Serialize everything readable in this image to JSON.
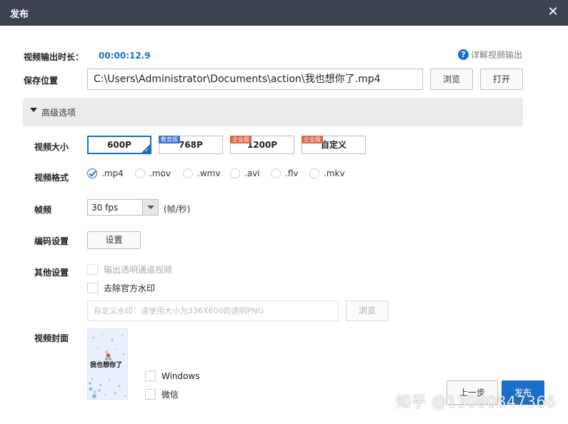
{
  "window": {
    "title": "发布",
    "close_glyph": "✕"
  },
  "duration": {
    "label": "视频输出时长：",
    "value": "00:00:12.9"
  },
  "help": {
    "icon": "question-circle-icon",
    "label": "详解视频输出"
  },
  "save_location": {
    "label": "保存位置",
    "path": "C:\\Users\\Administrator\\Documents\\action\\我也想你了.mp4",
    "browse_label": "浏览",
    "open_label": "打开"
  },
  "advanced": {
    "label": "高级选项",
    "expanded": true
  },
  "video_size": {
    "label": "视频大小",
    "options": [
      {
        "label": "600P",
        "badge": "",
        "selected": true
      },
      {
        "label": "768P",
        "badge": "教育版",
        "selected": false
      },
      {
        "label": "1200P",
        "badge": "企业版",
        "selected": false
      },
      {
        "label": "自定义",
        "badge": "企业版",
        "selected": false
      }
    ]
  },
  "video_format": {
    "label": "视频格式",
    "options": [
      {
        "label": ".mp4",
        "selected": true
      },
      {
        "label": ".mov",
        "selected": false
      },
      {
        "label": ".wmv",
        "selected": false
      },
      {
        "label": ".avi",
        "selected": false
      },
      {
        "label": ".flv",
        "selected": false
      },
      {
        "label": ".mkv",
        "selected": false
      }
    ]
  },
  "frame_rate": {
    "label": "帧频",
    "value": "30 fps",
    "unit": "(帧/秒)"
  },
  "encoding": {
    "label": "编码设置",
    "button_label": "设置"
  },
  "other": {
    "label": "其他设置",
    "transparent_channel": {
      "label": "输出透明通道视频",
      "checked": false,
      "disabled": true
    },
    "remove_watermark": {
      "label": "去除官方水印",
      "checked": false,
      "disabled": false
    },
    "custom_watermark_placeholder": "自定义水印：请使用大小为336X600的透明PNG",
    "watermark_browse_label": "浏览"
  },
  "cover": {
    "label": "视频封面",
    "thumbnail_text": "我也想你了",
    "options": [
      {
        "label": "Windows",
        "checked": false
      },
      {
        "label": "微信",
        "checked": false
      }
    ]
  },
  "footer": {
    "prev_label": "上一步",
    "publish_label": "发布"
  },
  "overlay_watermark": "知乎 @13080847366",
  "colors": {
    "accent": "#1a6fc8",
    "titlebar": "#3d4450",
    "section_bg": "#ebebeb",
    "badge_edu": "#3b6fd1",
    "badge_ent": "#d9644a"
  }
}
